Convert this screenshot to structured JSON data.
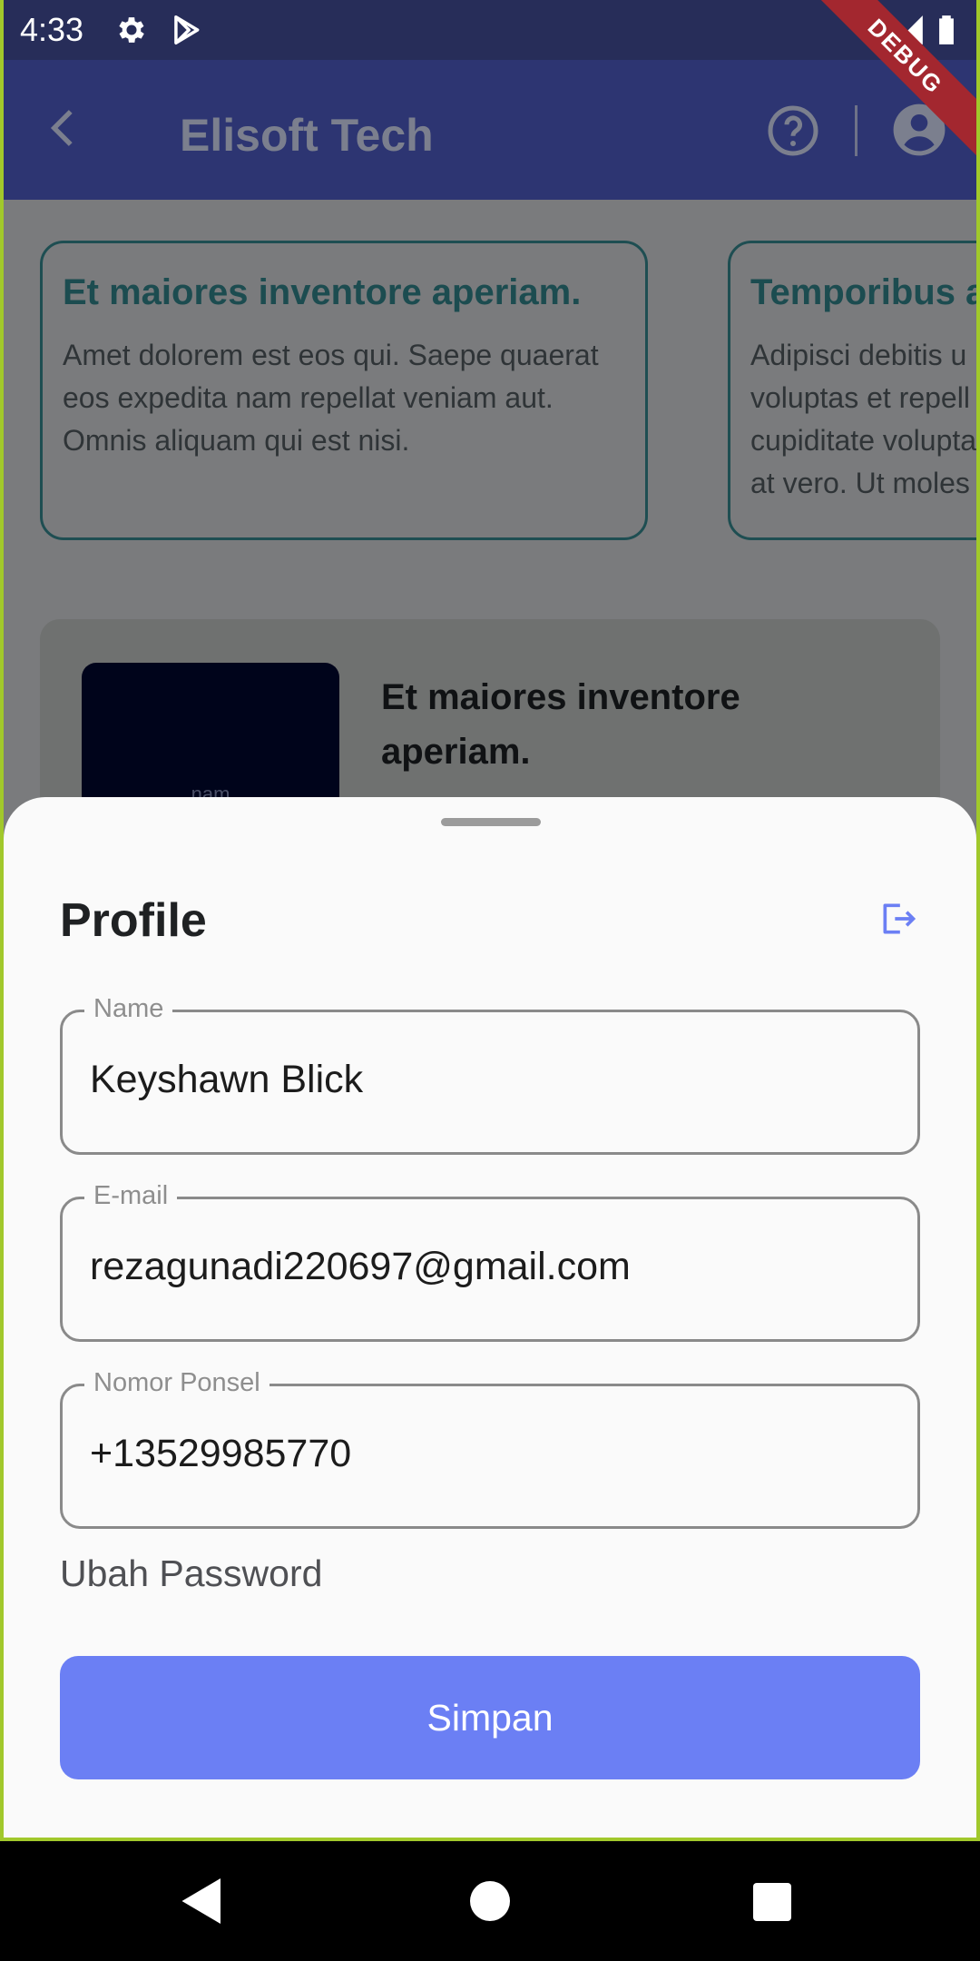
{
  "status_bar": {
    "time": "4:33",
    "debug_label": "DEBUG",
    "icons": [
      "gear-icon",
      "play-store-icon",
      "wifi-icon",
      "signal-icon",
      "battery-icon"
    ]
  },
  "app_bar": {
    "title": "Elisoft Tech",
    "back_icon": "chevron-left-icon",
    "help_icon": "help-circle-icon",
    "account_icon": "account-circle-icon"
  },
  "background": {
    "cards": [
      {
        "title": "Et maiores inventore aperiam.",
        "body": [
          "Amet dolorem est eos qui. Saepe quaerat",
          "eos expedita nam repellat veniam aut.",
          "Omnis aliquam qui est nisi."
        ]
      },
      {
        "title": "Temporibus a",
        "body": [
          "Adipisci debitis u",
          "voluptas et repell",
          "cupiditate volupta",
          "at vero. Ut moles"
        ]
      }
    ],
    "feature": {
      "thumb_text": "nam",
      "title": "Et maiores inventore aperiam."
    }
  },
  "sheet": {
    "title": "Profile",
    "logout_icon": "logout-icon",
    "fields": {
      "name": {
        "label": "Name",
        "value": "Keyshawn Blick"
      },
      "email": {
        "label": "E-mail",
        "value": "rezagunadi220697@gmail.com"
      },
      "phone": {
        "label": "Nomor Ponsel",
        "value": "+13529985770"
      }
    },
    "change_password": "Ubah Password",
    "save_label": "Simpan"
  },
  "colors": {
    "primary": "#6b7ff4",
    "app_bar": "#2d3572",
    "card_title": "#1c4c50",
    "debug": "#a3272f"
  },
  "nav_bar": {
    "icons": [
      "back-triangle-icon",
      "home-circle-icon",
      "recents-square-icon"
    ]
  }
}
